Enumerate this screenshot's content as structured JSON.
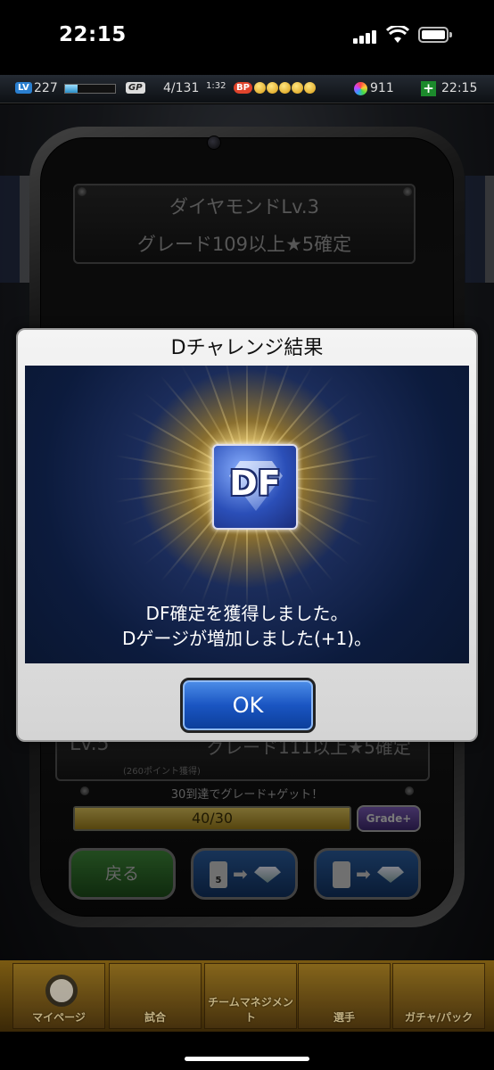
{
  "status_bar": {
    "time": "22:15"
  },
  "info_bar": {
    "lv_tag": "LV",
    "lv": "227",
    "exp_fraction": 0.25,
    "gp_tag": "GP",
    "gp": "4/131",
    "gp_timer": "1:32",
    "bp_tag": "BP",
    "bp_coins": 5,
    "gems": "911",
    "plus": "+",
    "clock": "22:15"
  },
  "rank": {
    "title": "ダイヤモンドLv.3",
    "subtitle": "グレード109以上★5確定"
  },
  "next_rank": {
    "title": "Lv.5",
    "desc": "グレード111以上★5確定",
    "points": "(260ポイント獲得)"
  },
  "progress": {
    "caption": "30到達でグレード+ゲット！",
    "text": "40/30",
    "fraction": 1.0,
    "grade_button": "Grade+"
  },
  "actions": {
    "back": "戻る",
    "card_number": "5",
    "arrow": "➡"
  },
  "modal": {
    "title": "Dチャレンジ結果",
    "icon_text": "DF",
    "line1": "DF確定を獲得しました。",
    "line2": "Dゲージが増加しました(+1)。",
    "ok": "OK"
  },
  "nav": {
    "items": [
      {
        "label": "マイページ"
      },
      {
        "label": "試合"
      },
      {
        "label": "チームマネジメント"
      },
      {
        "label": "選手"
      },
      {
        "label": "ガチャ/パック"
      }
    ]
  },
  "colors": {
    "modal_bg": "#0c1b3d",
    "ok_button": "#1a55c2",
    "back_button": "#3f8a3a",
    "grade_button": "#7b5bb6"
  }
}
